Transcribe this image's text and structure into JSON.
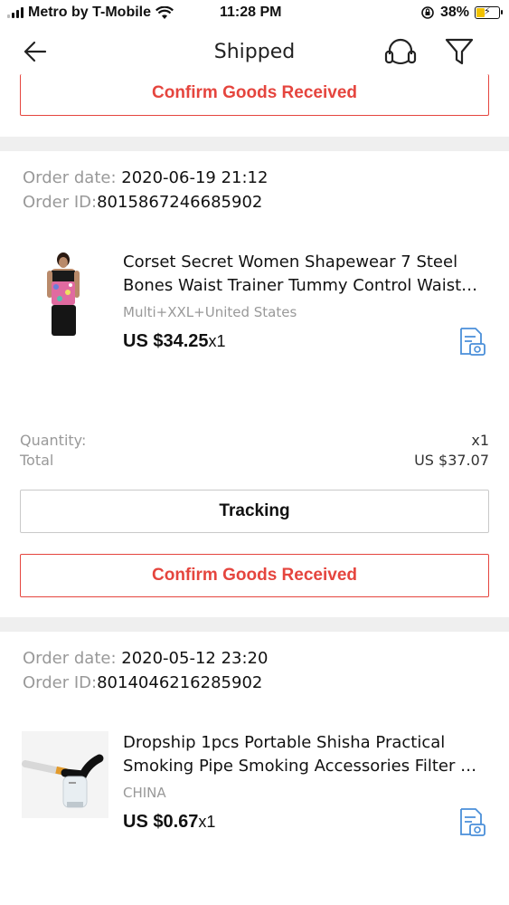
{
  "status_bar": {
    "carrier": "Metro by T-Mobile",
    "time": "11:28 PM",
    "battery": "38%",
    "battery_level": 0.38,
    "wifi_icon": "wifi-icon",
    "rotation_lock_icon": "rotation-lock-icon"
  },
  "nav": {
    "title": "Shipped",
    "back_icon": "back-arrow-icon",
    "support_icon": "headset-icon",
    "filter_icon": "filter-icon"
  },
  "top_partial": {
    "confirm_label": "Confirm Goods Received"
  },
  "orders": [
    {
      "date_label": "Order date: ",
      "date": "2020-06-19 21:12",
      "id_label": "Order ID:",
      "id": "8015867246685902",
      "product": {
        "name_line1": "Corset Secret Women Shapewear 7 Steel",
        "name_line2": "Bones Waist Trainer Tummy Control Waist…",
        "variant": "Multi+XXL+United States",
        "price": "US $34.25",
        "qty": "x1"
      },
      "quantity_label": "Quantity:",
      "quantity_value": "x1",
      "total_label": "Total",
      "total_value": "US $37.07",
      "tracking_label": "Tracking",
      "confirm_label": "Confirm Goods Received"
    },
    {
      "date_label": "Order date: ",
      "date": "2020-05-12 23:20",
      "id_label": "Order ID:",
      "id": "8014046216285902",
      "product": {
        "name_line1": "Dropship 1pcs Portable Shisha Practical",
        "name_line2": "Smoking Pipe Smoking Accessories Filter W…",
        "variant": "CHINA",
        "price": "US $0.67",
        "qty": "x1"
      }
    }
  ],
  "colors": {
    "accent_red": "#e5453e",
    "separator": "#efefef",
    "snapshot_blue": "#4a8fd9"
  }
}
